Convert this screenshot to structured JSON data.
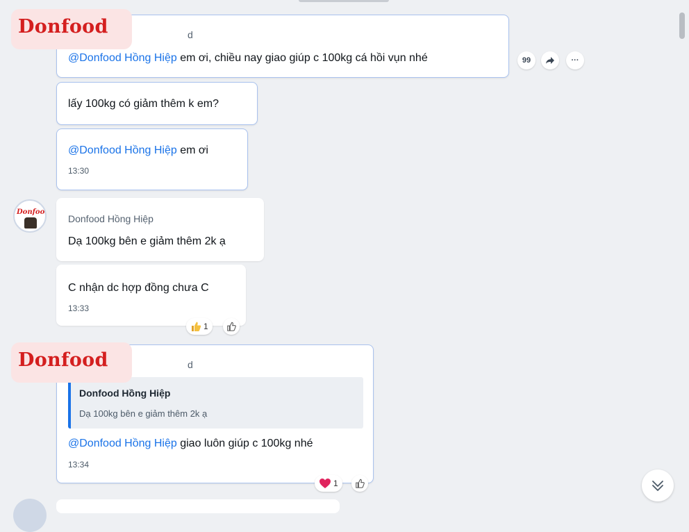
{
  "brand": {
    "logo_text": "Donfood",
    "trailing_char": "d"
  },
  "messages": {
    "m1": {
      "mention": "@Donfood Hồng Hiệp",
      "text": " em ơi, chiều nay giao giúp c 100kg cá hồi vụn nhé"
    },
    "m2": {
      "text": "lấy 100kg có giảm thêm k em?"
    },
    "m3": {
      "mention": "@Donfood Hồng Hiệp",
      "text": " em ơi",
      "time": "13:30"
    },
    "m4": {
      "sender": "Donfood Hồng Hiệp",
      "text": "Dạ 100kg bên e giảm thêm 2k ạ"
    },
    "m5": {
      "text": "C nhận dc hợp đồng chưa C",
      "time": "13:33",
      "reaction_count": "1"
    },
    "m6": {
      "quote_author": "Donfood Hồng Hiệp",
      "quote_text": "Dạ 100kg bên e giảm thêm 2k ạ",
      "mention": "@Donfood Hồng Hiệp",
      "text": " giao luôn giúp c 100kg nhé",
      "time": "13:34",
      "reaction_count": "1"
    }
  },
  "actions": {
    "quote_label": "99",
    "more_label": "···"
  },
  "avatar": {
    "logo_text": "Donfood"
  },
  "colors": {
    "mention": "#1a73e8",
    "brand_red": "#d41f1f",
    "badge_bg": "#fbe4e4",
    "own_border": "#a9c2ee"
  },
  "icons": [
    "quote-icon",
    "share-icon",
    "more-icon",
    "like-icon",
    "heart-icon",
    "thumbs-up-emoji",
    "chevron-double-down-icon"
  ]
}
